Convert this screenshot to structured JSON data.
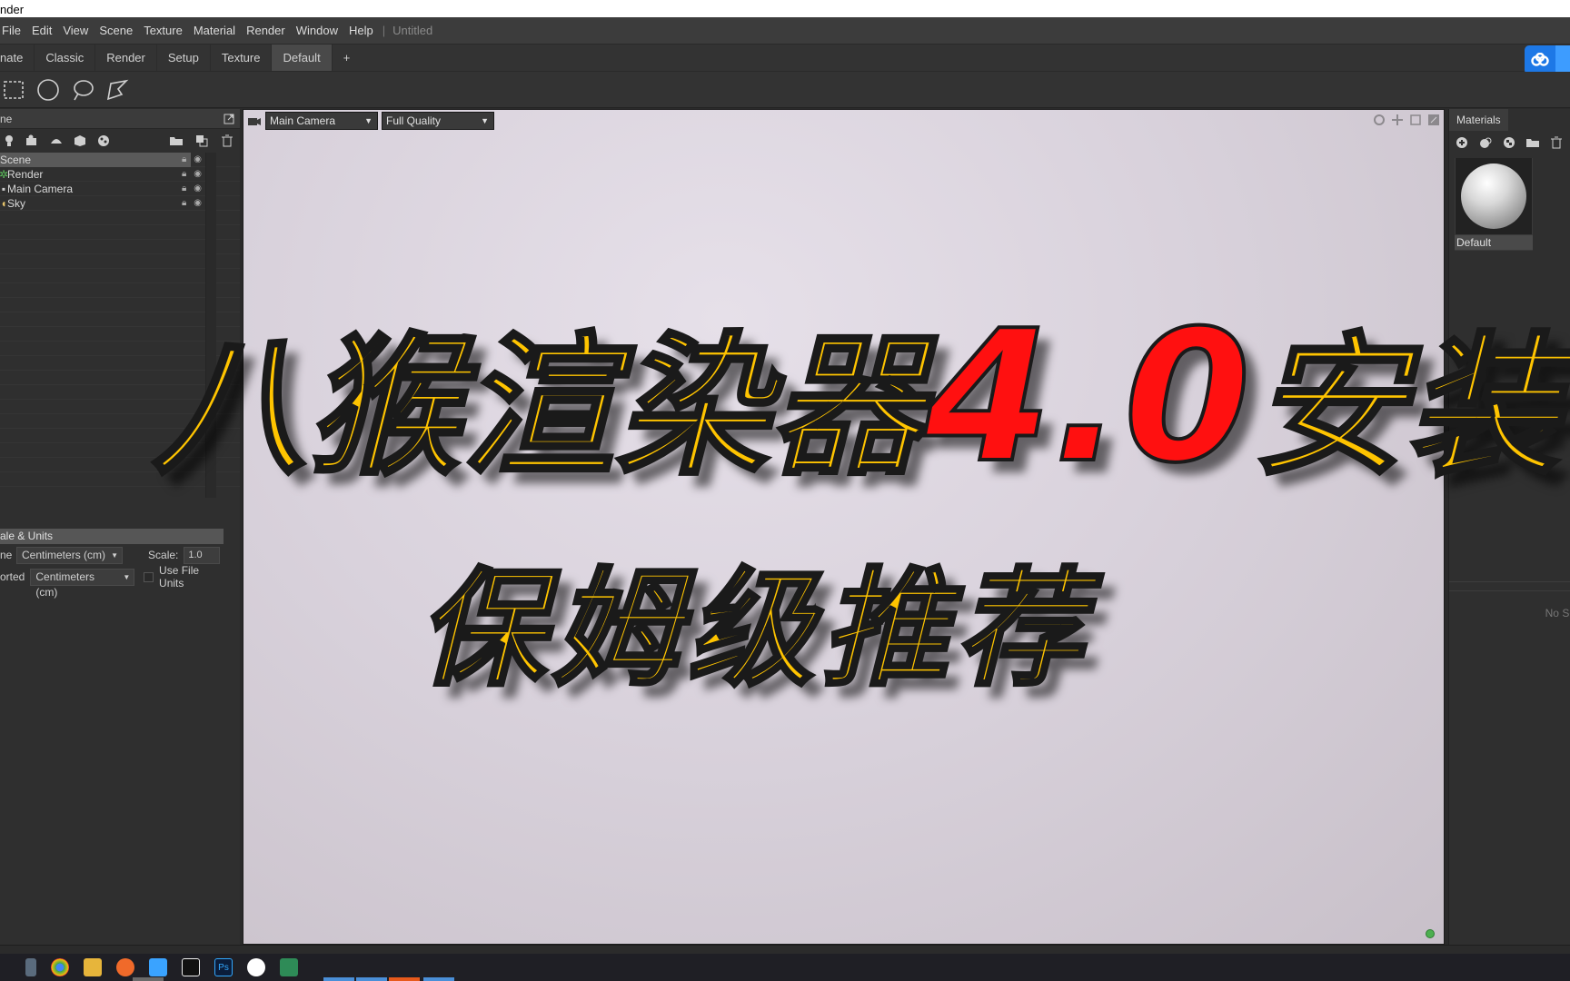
{
  "window": {
    "title": "nder"
  },
  "menu": {
    "items": [
      "File",
      "Edit",
      "View",
      "Scene",
      "Texture",
      "Material",
      "Render",
      "Window",
      "Help"
    ],
    "separator": "|",
    "document": "Untitled"
  },
  "tabs": {
    "items": [
      "nate",
      "Classic",
      "Render",
      "Setup",
      "Texture",
      "Default"
    ],
    "active": "Default",
    "add": "+"
  },
  "toolbar": {
    "tools": [
      "rect-select-icon",
      "circle-select-icon",
      "lasso-select-icon",
      "poly-select-icon"
    ]
  },
  "scene_panel": {
    "header": "ne",
    "tree": [
      {
        "label": "Scene",
        "selected": true
      },
      {
        "label": "Render"
      },
      {
        "label": "Main Camera"
      },
      {
        "label": "Sky"
      }
    ]
  },
  "properties": {
    "section": "ale & Units",
    "row1_label": "ne",
    "row1_value": "Centimeters (cm)",
    "scale_label": "Scale:",
    "scale_value": "1.0",
    "row2_label": "orted",
    "row2_value": "Centimeters (cm)",
    "use_file_units": "Use File Units"
  },
  "viewport": {
    "camera": "Main Camera",
    "quality": "Full Quality"
  },
  "overlay": {
    "line1_a": "八猴渲染器",
    "line1_b": "4.0",
    "line1_c": "安装",
    "line2": "保姆级推荐"
  },
  "materials": {
    "tab": "Materials",
    "items": [
      "Default"
    ],
    "empty_note": "No Se"
  },
  "colors": {
    "accent_blue": "#1d78e6",
    "title_yellow": "#ffc400",
    "title_red": "#ff1010"
  }
}
